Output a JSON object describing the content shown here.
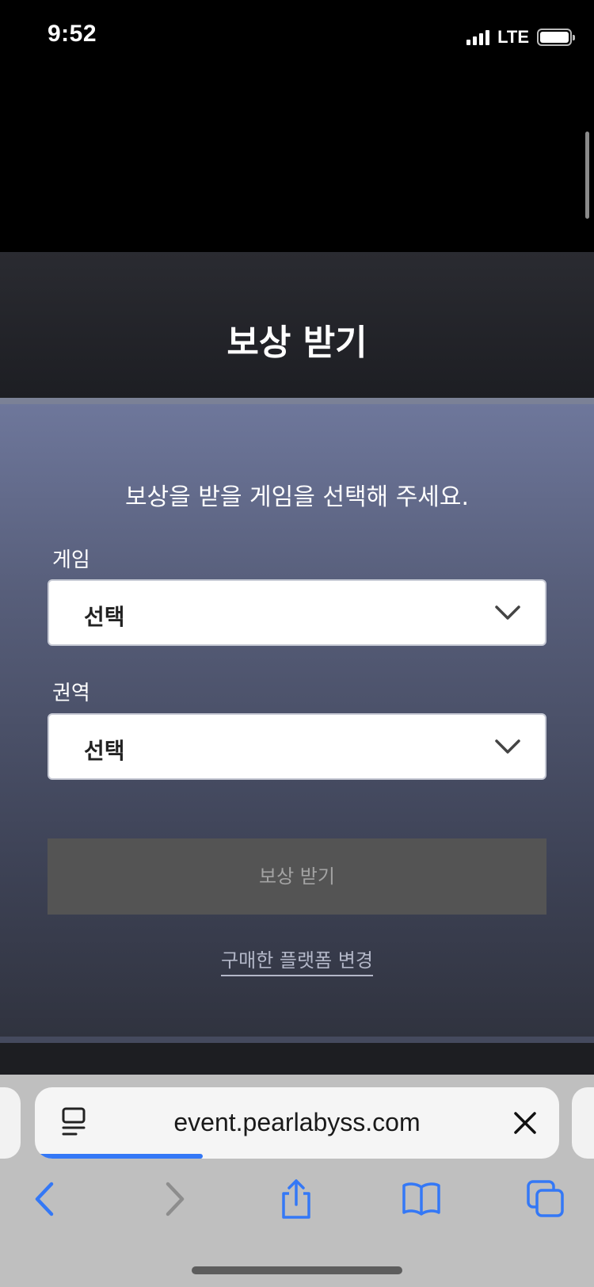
{
  "status_bar": {
    "time": "9:52",
    "network": "LTE"
  },
  "header": {
    "title": "보상 받기"
  },
  "form": {
    "instruction": "보상을 받을 게임을 선택해 주세요.",
    "game_label": "게임",
    "game_value": "선택",
    "region_label": "권역",
    "region_value": "선택",
    "submit_label": "보상 받기",
    "change_platform_link": "구매한 플랫폼 변경"
  },
  "browser": {
    "url": "event.pearlabyss.com",
    "load_progress_percent": 32,
    "icons": [
      "reader-icon",
      "close-icon",
      "back-icon",
      "forward-icon",
      "share-icon",
      "bookmarks-icon",
      "tabs-icon"
    ]
  },
  "colors": {
    "accent_blue": "#3478f6",
    "button_disabled_bg": "#545454",
    "panel_top": "#6e779b",
    "panel_bottom": "#30333f"
  }
}
